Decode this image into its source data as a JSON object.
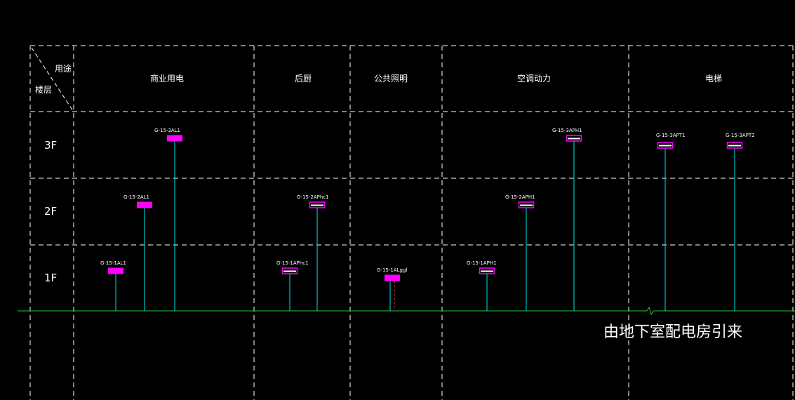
{
  "header": {
    "usage_label": "用途",
    "floor_label": "楼层"
  },
  "columns": [
    {
      "key": "commercial",
      "label": "商业用电"
    },
    {
      "key": "kitchen",
      "label": "后厨"
    },
    {
      "key": "public_lighting",
      "label": "公共照明"
    },
    {
      "key": "hvac",
      "label": "空调动力"
    },
    {
      "key": "elevator",
      "label": "电梯"
    }
  ],
  "floors": [
    "3F",
    "2F",
    "1F"
  ],
  "panels": [
    {
      "id": "G-15-1AL1",
      "column": "commercial",
      "floor": "1F",
      "style": "filled"
    },
    {
      "id": "G-15-2AL1",
      "column": "commercial",
      "floor": "2F",
      "style": "filled"
    },
    {
      "id": "G-15-3AL1",
      "column": "commercial",
      "floor": "3F",
      "style": "filled"
    },
    {
      "id": "G-15-1APhc1",
      "column": "kitchen",
      "floor": "1F",
      "style": "outline"
    },
    {
      "id": "G-15-2APhc1",
      "column": "kitchen",
      "floor": "2F",
      "style": "outline"
    },
    {
      "id": "G-15-1ALggl",
      "column": "public_lighting",
      "floor": "1F",
      "style": "filled"
    },
    {
      "id": "G-15-1APH1",
      "column": "hvac",
      "floor": "1F",
      "style": "outline"
    },
    {
      "id": "G-15-2APH1",
      "column": "hvac",
      "floor": "2F",
      "style": "outline"
    },
    {
      "id": "G-15-3APH1",
      "column": "hvac",
      "floor": "3F",
      "style": "outline"
    },
    {
      "id": "G-15-3APT1",
      "column": "elevator",
      "floor": "3F",
      "style": "outline"
    },
    {
      "id": "G-15-3APT2",
      "column": "elevator",
      "floor": "3F",
      "style": "outline"
    }
  ],
  "feed_note": "由地下室配电房引来",
  "colors": {
    "background": "#000000",
    "grid": "#ffffff",
    "panel": "#ff00ff",
    "riser": "#00e5e5",
    "bus": "#22cc22",
    "dashed_red": "#ff3030",
    "text": "#ffffff"
  }
}
